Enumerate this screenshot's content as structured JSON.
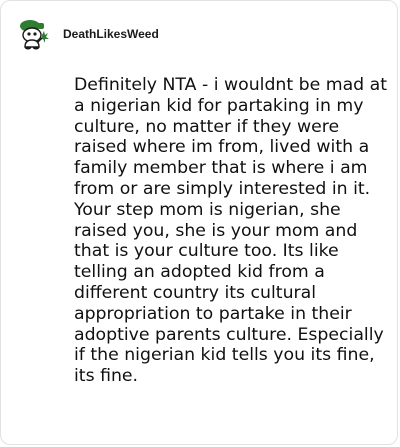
{
  "comment": {
    "author": "DeathLikesWeed",
    "avatar_icon": "snoo-avatar-icon",
    "body": "Definitely NTA - i wouldnt be mad at a nigerian kid for partaking in my culture, no matter if they were raised where im from, lived with a family member that is where i am from or are simply interested in it. Your step mom is nigerian, she raised you, she is your mom and that is your culture too. Its like telling an adopted kid from a different country its cultural appropriation to partake in their adoptive parents culture. Especially if the nigerian kid tells you its fine, its fine."
  },
  "colors": {
    "avatar_green": "#2e7d32",
    "text": "#111111",
    "border": "#e2e2e2"
  }
}
